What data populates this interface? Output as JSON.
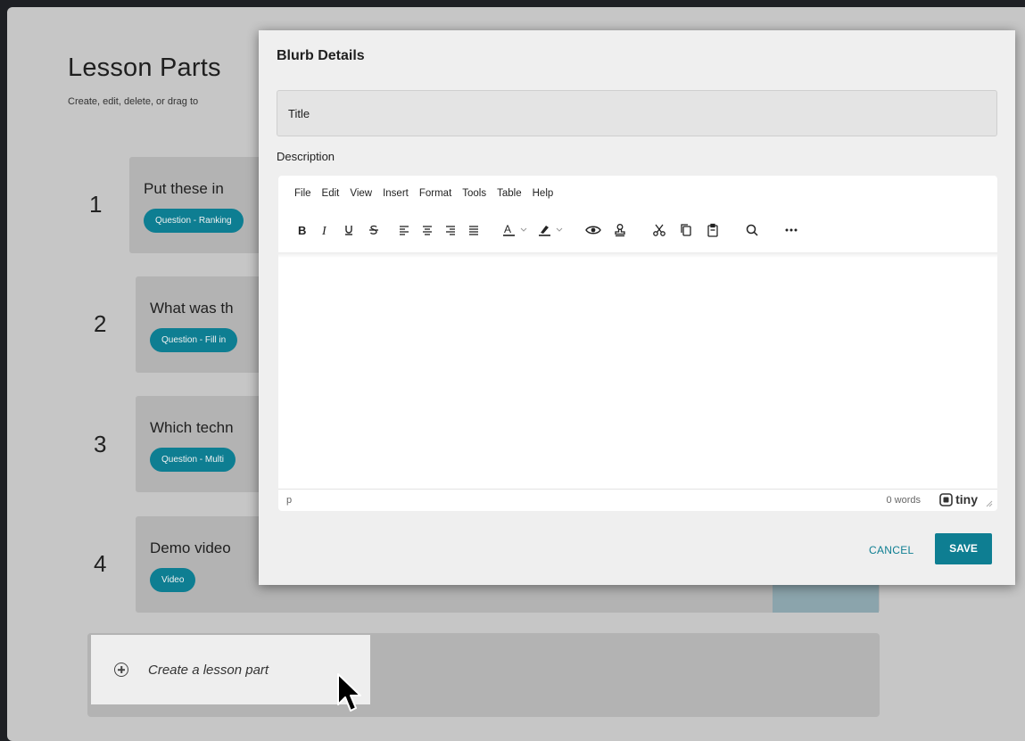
{
  "page": {
    "title": "Lesson Parts",
    "subtitle": "Create, edit, delete, or drag to"
  },
  "lesson_parts": [
    {
      "number": "1",
      "title": "Put these in",
      "badge": "Question - Ranking"
    },
    {
      "number": "2",
      "title": "What was th",
      "badge": "Question - Fill in"
    },
    {
      "number": "3",
      "title": "Which techn",
      "badge": "Question - Multi"
    },
    {
      "number": "4",
      "title": "Demo video",
      "badge": "Video"
    }
  ],
  "create_part": {
    "label": "Create a lesson part"
  },
  "modal": {
    "title": "Blurb Details",
    "title_placeholder": "Title",
    "description_label": "Description",
    "menu": [
      "File",
      "Edit",
      "View",
      "Insert",
      "Format",
      "Tools",
      "Table",
      "Help"
    ],
    "toolbar_icons": [
      "bold-icon",
      "italic-icon",
      "underline-icon",
      "strikethrough-icon",
      "align-left-icon",
      "align-center-icon",
      "align-right-icon",
      "align-justify-icon",
      "text-color-icon",
      "highlight-color-icon",
      "preview-icon",
      "stamp-icon",
      "cut-icon",
      "copy-icon",
      "paste-icon",
      "search-icon",
      "more-icon"
    ],
    "status_path": "p",
    "word_count": "0 words",
    "brand": "tiny",
    "cancel_label": "CANCEL",
    "save_label": "SAVE"
  },
  "colors": {
    "accent": "#0e7e92",
    "backdrop": "#c6c6c6",
    "card": "#b3b3b3"
  }
}
